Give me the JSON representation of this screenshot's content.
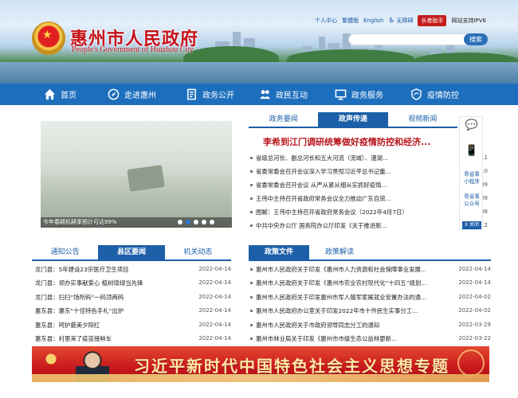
{
  "header": {
    "emblem_glyph": "★",
    "title": "惠州市人民政府",
    "subtitle": "People's Government of Huizhou City",
    "toplinks": {
      "personal_center": "个人中心",
      "traditional": "繁體版",
      "english": "English",
      "accessibility": "无障碍",
      "elder_helper": "长者助手",
      "ipv6": "网站支持IPV6"
    },
    "search": {
      "placeholder": "",
      "button_label": "搜索"
    }
  },
  "nav": [
    {
      "label": "首页",
      "icon": "home-icon"
    },
    {
      "label": "走进惠州",
      "icon": "compass-icon"
    },
    {
      "label": "政务公开",
      "icon": "document-icon"
    },
    {
      "label": "政民互动",
      "icon": "people-icon"
    },
    {
      "label": "政务服务",
      "icon": "monitor-icon"
    },
    {
      "label": "疫情防控",
      "icon": "shield-icon"
    }
  ],
  "slider": {
    "caption": "今年春耕机耕率预计可达99%",
    "dots": 5,
    "active_dot": 1
  },
  "center_tabs": [
    "政务要闻",
    "政声传递",
    "视频新闻"
  ],
  "center_active_tab": 1,
  "headline": "李希到江门调研统筹做好疫情防控和经济...",
  "news": [
    {
      "title": "省级总河长、副总河长和五大河流（流域）、漫湖...",
      "date": "-11"
    },
    {
      "title": "省委常委会召开会议深入学习贯彻习近平总书记重...",
      "date": "-10"
    },
    {
      "title": "省委常委会召开会议 从严从紧从细从实抓好疫情...",
      "date": "-09"
    },
    {
      "title": "王伟中主持召开省政府常务会议全力推动广东自贸...",
      "date": "-09"
    },
    {
      "title": "图解：王伟中主持召开省政府常务会议（2022年4月7日）",
      "date": "-08"
    },
    {
      "title": "中共中央办公厅 国务院办公厅印发《关于推进新...",
      "date": "-12"
    }
  ],
  "float_bar": {
    "miniprogram_label": "粤省事小程序",
    "official_label": "粤省事公众号",
    "close_label": "X 关闭"
  },
  "left_tabs": [
    "通知公告",
    "县区要闻",
    "机关动态"
  ],
  "left_active_tab": 1,
  "left_items": [
    {
      "title": "龙门县：5年建设23宗医疗卫生项目",
      "date": "2022-04-14"
    },
    {
      "title": "龙门县：领办实事献爱心 植树增绿当先锋",
      "date": "2022-04-14"
    },
    {
      "title": "龙门县：扫扫“场所码”一码顶两码",
      "date": "2022-04-14"
    },
    {
      "title": "惠东县：惠东“十佳特色手礼”出炉",
      "date": "2022-04-14"
    },
    {
      "title": "惠东县：呵护最美夕阳红",
      "date": "2022-04-14"
    },
    {
      "title": "惠东县：村里来了疫苗接种车",
      "date": "2022-04-14"
    }
  ],
  "right_tabs": [
    "政策文件",
    "政策解读"
  ],
  "right_active_tab": 0,
  "right_items": [
    {
      "title": "惠州市人民政府关于印发《惠州市人力资源和社会保障事业发展...",
      "date": "2022-04-14"
    },
    {
      "title": "惠州市人民政府关于印发《惠州市农业农村现代化“十四五”规划...",
      "date": "2022-04-14"
    },
    {
      "title": "惠州市人民政府关于印发惠州市军人随军家属就业安置办法的通...",
      "date": "2022-04-02"
    },
    {
      "title": "惠州市人民政府办公室关于印发2022年市十件民生实事分工...",
      "date": "2022-04-02"
    },
    {
      "title": "惠州市人民政府关于市政府领导同志分工的通知",
      "date": "2022-03-29"
    },
    {
      "title": "惠州市林业局关于印发《惠州市市级生态公益林更新...",
      "date": "2022-03-22"
    }
  ],
  "banner": {
    "title": "习近平新时代中国特色社会主义思想专题"
  }
}
